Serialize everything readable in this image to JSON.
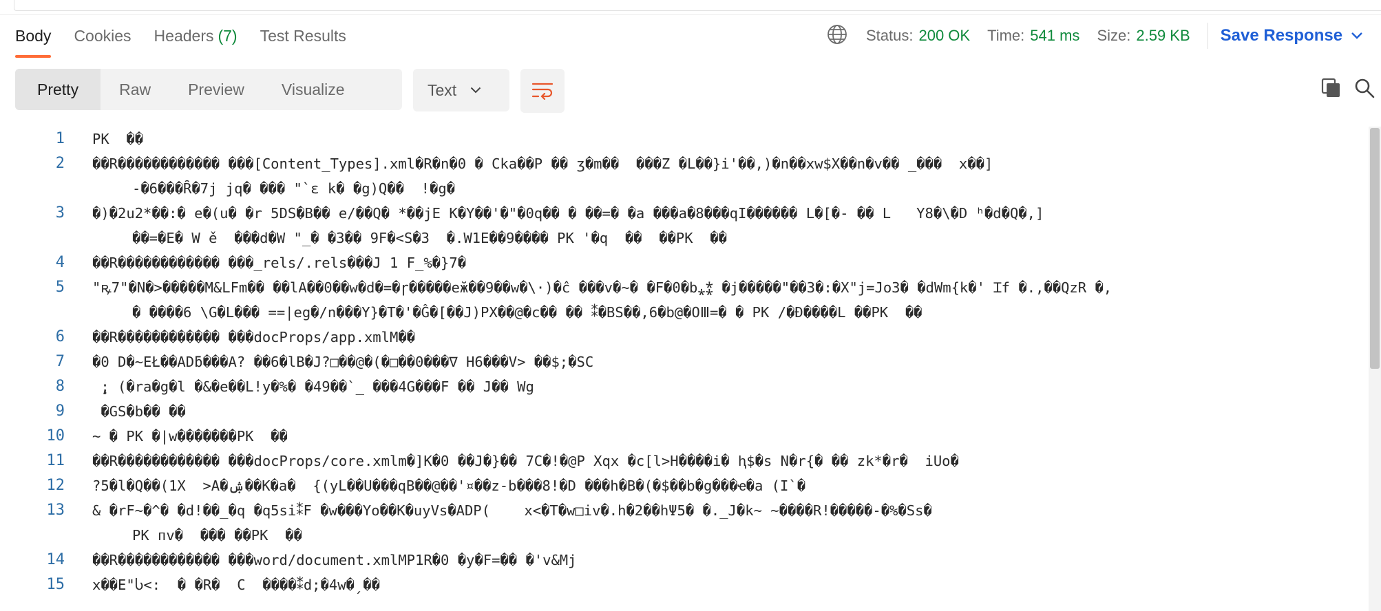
{
  "tabs": [
    {
      "label": "Body",
      "count": ""
    },
    {
      "label": "Cookies",
      "count": ""
    },
    {
      "label": "Headers",
      "count": "(7)"
    },
    {
      "label": "Test Results",
      "count": ""
    }
  ],
  "status": {
    "status_label": "Status:",
    "status_value": "200 OK",
    "time_label": "Time:",
    "time_value": "541 ms",
    "size_label": "Size:",
    "size_value": "2.59 KB"
  },
  "save_response_label": "Save Response",
  "format_tabs": [
    "Pretty",
    "Raw",
    "Preview",
    "Visualize"
  ],
  "type_select": "Text",
  "icons": {
    "globe": "globe-icon",
    "save_chevron": "chevron-down-icon",
    "type_chevron": "chevron-down-icon",
    "wrap": "wrap-lines-icon",
    "copy": "copy-icon",
    "search": "search-icon"
  },
  "colors": {
    "accent": "#ff6c37",
    "success": "#0f8a3c",
    "link": "#1f5fd6",
    "line_number": "#2e6ea6"
  },
  "body_lines": [
    {
      "n": "1",
      "text": "PK  ��"
    },
    {
      "n": "2",
      "text": "��R������������ ���[Content_Types].xml�R�n�0 � Cka��P �� ʒ�m��  ���Z �L��}i'��,)�n��xw$X��n�v�� _���  x��]"
    },
    {
      "n": "",
      "text": "-�6���Ȓ�7j jq� ��� \"`ɛ k� �g)Q��  !�g�"
    },
    {
      "n": "3",
      "text": "�)�2u2*��:� e�(u� �r 5DS�B�� e/��Q� *��jE K�Y��'�\"�0q�� � ��=� �a ���a�8���qI������ L�[�- �� L   Y8�\\�D ʰ�d�Q�,]"
    },
    {
      "n": "",
      "text": "��=�E� W ě  ���d�W \"_� �3�� 9F�<S�3  �.W1E��9���� PK '�q  ��  ��PK  ��"
    },
    {
      "n": "4",
      "text": "��R������������ ���_rels/.rels���J 1 F_%�}7�"
    },
    {
      "n": "5",
      "text": "\"ꝶ7\"�N�>�����M&LFm�� ��lA��0��w�d�=�ɼ�����eӂ��9��w�\\·)�ĉ ���v�~� �F�0�b⁎⁑ �j�����\"��3�:�X\"j=Jo3� �dWm{k�' Ɪf �.,��QzR �,"
    },
    {
      "n": "",
      "text": "� ����6 \\G�L��� ==|eg�/n���Y}�T�'�Ĝ�[��J)PX��@�c�� �� ⁑�BS��,6�b@�OⅢ=� � PK /�Ɖ����L ��PK  ��"
    },
    {
      "n": "6",
      "text": "��R������������ ���docProps/app.xmlM��"
    },
    {
      "n": "7",
      "text": "�0 D�~EŁ��ADƃ���A? ��6�lB�J?□��@�(�□��0���∇ H6���V> ��$;�SC"
    },
    {
      "n": "8",
      "text": " ̧; (�ra�g�l �&�e��L!y�%� �49��`_ ���4G���F �� J�� Wg"
    },
    {
      "n": "9",
      "text": " �GS�b�� ��"
    },
    {
      "n": "10",
      "text": "~ � PK �|w�������PK  ��"
    },
    {
      "n": "11",
      "text": "��R������������ ���docProps/core.xmlm�]K�0 ��J�}�� 7C�!�@P Xqx �c[l>H����i� ⱨ$�s N�r{� �� zk*�r�  iUo�"
    },
    {
      "n": "12",
      "text": "?5�l�Q��(1X  >A�ۺ��K�a�  {(yL��U���qB��@��'¤��z-b���8!�D ���h�B�(�$��b�g���ҽ�a (I`�"
    },
    {
      "n": "13",
      "text": "& �rF~�^� �d!��_�q �q5si⁑F �w���Yo��K�uyVs�ADP(    x<�T�w□iv�.h�2��hΨ5� �._J�k~ ~����R!�����-�%�Ss�"
    },
    {
      "n": "",
      "text": "PK ᴨv�  ��� ��PK  ��"
    },
    {
      "n": "14",
      "text": "��R������������ ���word/document.xmlMP1R�0 �y�F=�� �'v&Mj"
    },
    {
      "n": "15",
      "text": "x��E\"Ⴑ<:  � �R�  C  ����⁑d;�4w�ˏ��"
    }
  ]
}
